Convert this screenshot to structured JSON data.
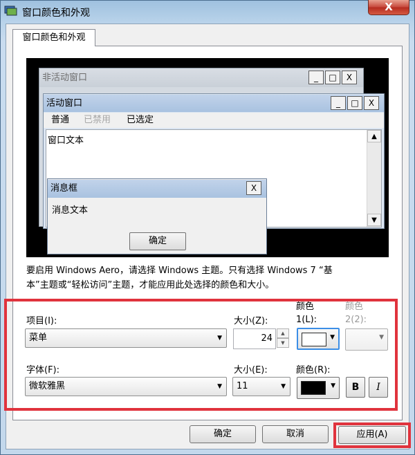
{
  "window": {
    "title": "窗口颜色和外观",
    "close_symbol": "X"
  },
  "tab": {
    "label": "窗口颜色和外观"
  },
  "preview": {
    "inactive_title": "非活动窗口",
    "active_title": "活动窗口",
    "menu": {
      "normal": "普通",
      "disabled": "已禁用",
      "selected": "已选定"
    },
    "window_text": "窗口文本",
    "message_box_title": "消息框",
    "message_text": "消息文本",
    "ok_label": "确定",
    "caption_buttons": {
      "minimize": "_",
      "maximize": "□",
      "close": "X"
    }
  },
  "description": {
    "line1": "要启用 Windows Aero，请选择 Windows 主题。只有选择 Windows 7 “基",
    "line2": "本”主题或“轻松访问”主题，才能应用此处选择的颜色和大小。"
  },
  "controls": {
    "item_label": "项目(I):",
    "item_value": "菜单",
    "size_z_label": "大小(Z):",
    "size_z_value": "24",
    "color1_label_a": "颜色",
    "color1_label_b": "1(L):",
    "color1_value": "#ffffff",
    "color2_label_a": "颜色",
    "color2_label_b": "2(2):",
    "font_label": "字体(F):",
    "font_value": "微软雅黑",
    "size_e_label": "大小(E):",
    "size_e_value": "11",
    "color_r_label": "颜色(R):",
    "color_r_value": "#000000",
    "bold_label": "B",
    "italic_label": "I"
  },
  "buttons": {
    "ok": "确定",
    "cancel": "取消",
    "apply": "应用(A)"
  },
  "colors": {
    "highlight": "#e0333d",
    "active_caption": "#b6cbe5"
  }
}
